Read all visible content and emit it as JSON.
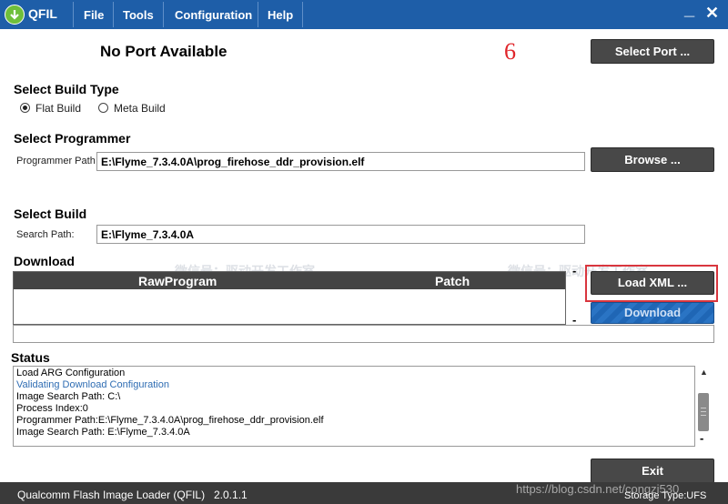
{
  "app": {
    "name": "QFIL",
    "menu": [
      "File",
      "Tools",
      "Configuration",
      "Help"
    ],
    "minimize_glyph": "_",
    "close_glyph": "✕"
  },
  "header": {
    "port_status": "No Port Available",
    "step_annotation": "6",
    "select_port_label": "Select Port ..."
  },
  "build_type": {
    "title": "Select Build Type",
    "options": [
      {
        "label": "Flat Build",
        "checked": true
      },
      {
        "label": "Meta Build",
        "checked": false
      }
    ]
  },
  "programmer": {
    "title": "Select Programmer",
    "path_label": "Programmer Path",
    "path_value": "E:\\Flyme_7.3.4.0A\\prog_firehose_ddr_provision.elf",
    "browse_label": "Browse ..."
  },
  "build": {
    "title": "Select Build",
    "search_label": "Search Path:",
    "search_value": "E:\\Flyme_7.3.4.0A"
  },
  "download": {
    "title": "Download",
    "columns": [
      "RawProgram",
      "Patch"
    ],
    "load_xml_label": "Load XML ...",
    "download_label": "Download",
    "minus_glyph": "-"
  },
  "status": {
    "title": "Status",
    "lines": [
      {
        "text": "Load ARG Configuration",
        "color": "#000000"
      },
      {
        "text": "Validating Download Configuration",
        "color": "#2f6db3"
      },
      {
        "text": "Image Search Path: C:\\",
        "color": "#000000"
      },
      {
        "text": "Process Index:0",
        "color": "#000000"
      },
      {
        "text": "Programmer Path:E:\\Flyme_7.3.4.0A\\prog_firehose_ddr_provision.elf",
        "color": "#000000"
      },
      {
        "text": "Image Search Path: E:\\Flyme_7.3.4.0A",
        "color": "#000000"
      }
    ],
    "scroll_up_glyph": "▲",
    "minus_glyph": "-"
  },
  "exit_label": "Exit",
  "footer": {
    "product": "Qualcomm Flash Image Loader (QFIL)",
    "version": "2.0.1.1",
    "watermark_url": "https://blog.csdn.net/congzi530",
    "storage": "Storage Type:UFS"
  },
  "watermarks": [
    "微信号：驱动开发工作室",
    "微信号：驱动开发工作室"
  ],
  "colors": {
    "titlebar": "#1e5ea8",
    "button_dark": "#484848",
    "download_button": "#1f66b5",
    "highlight_box": "#d9363e",
    "annotation": "#e0252a"
  }
}
